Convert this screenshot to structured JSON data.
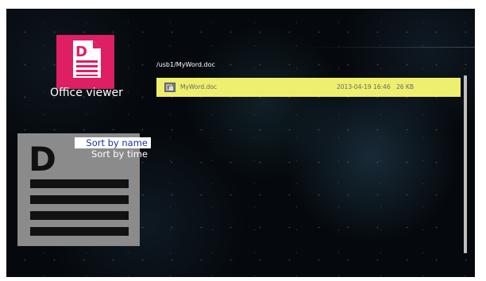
{
  "app": {
    "title": "Office viewer",
    "tile_letter": "D",
    "tile_icon": "document-icon",
    "accent_color": "#de1f63"
  },
  "preview": {
    "letter": "D",
    "icon": "document-icon"
  },
  "sort_menu": {
    "items": [
      {
        "label": "Sort by name",
        "selected": true
      },
      {
        "label": "Sort by time",
        "selected": false
      }
    ]
  },
  "browser": {
    "path": "/usb1/MyWord.doc",
    "highlight_color": "#eeef6f",
    "files": [
      {
        "icon": "file-icon",
        "name": "MyWord.doc",
        "modified": "2013-04-19 16:46",
        "size": "26 KB"
      }
    ]
  }
}
